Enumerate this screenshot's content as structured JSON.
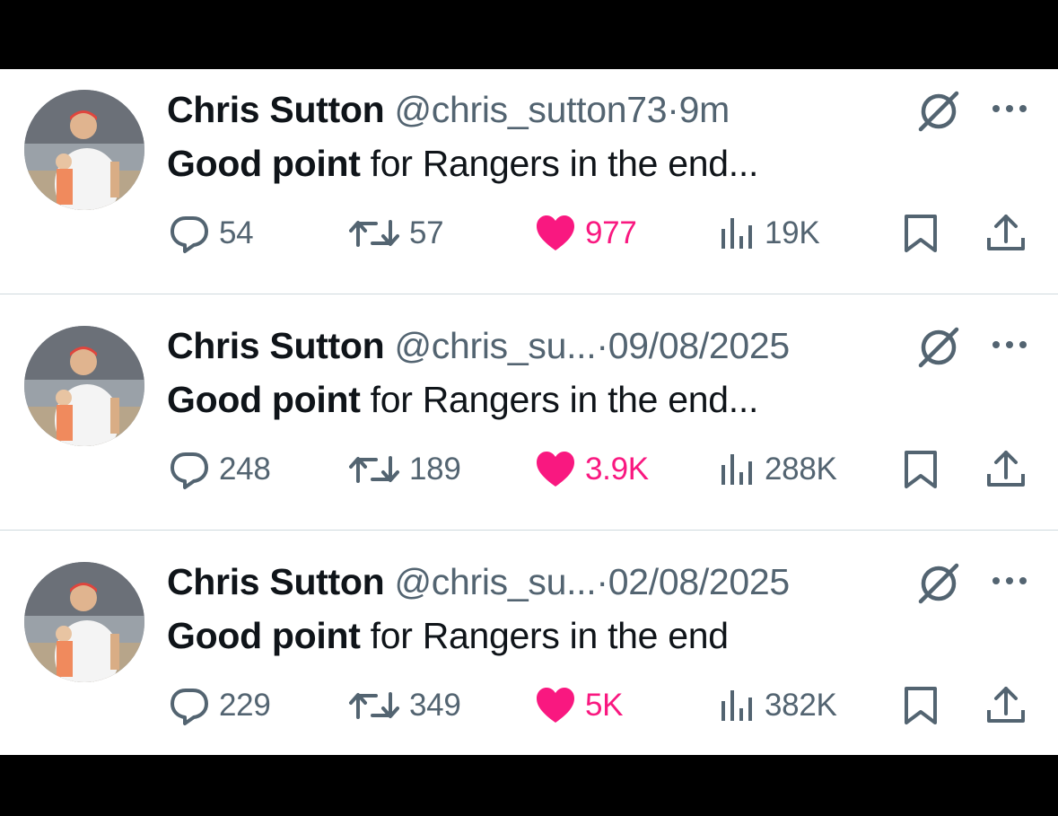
{
  "tweets": [
    {
      "author_name": "Chris Sutton",
      "handle": "@chris_sutton73",
      "separator": "·",
      "time": "9m",
      "text_bold": "Good point",
      "text_rest": " for Rangers in the end...",
      "replies": "54",
      "retweets": "57",
      "likes": "977",
      "views": "19K",
      "liked": true
    },
    {
      "author_name": "Chris Sutton",
      "handle": "@chris_su...",
      "separator": "·",
      "time": "09/08/2025",
      "text_bold": "Good point",
      "text_rest": " for Rangers in the end...",
      "replies": "248",
      "retweets": "189",
      "likes": "3.9K",
      "views": "288K",
      "liked": true
    },
    {
      "author_name": "Chris Sutton",
      "handle": "@chris_su...",
      "separator": "·",
      "time": "02/08/2025",
      "text_bold": "Good point",
      "text_rest": " for Rangers in the end",
      "replies": "229",
      "retweets": "349",
      "likes": "5K",
      "views": "382K",
      "liked": true
    }
  ],
  "icons": {
    "reply": "reply-icon",
    "retweet": "retweet-icon",
    "like": "heart-icon",
    "views": "views-icon",
    "bookmark": "bookmark-icon",
    "share": "share-icon",
    "grok": "grok-icon",
    "more": "more-icon"
  },
  "colors": {
    "text_primary": "#0f1419",
    "text_secondary": "#536471",
    "like_pink": "#f91880",
    "divider": "#cfd9de",
    "background": "#ffffff"
  }
}
